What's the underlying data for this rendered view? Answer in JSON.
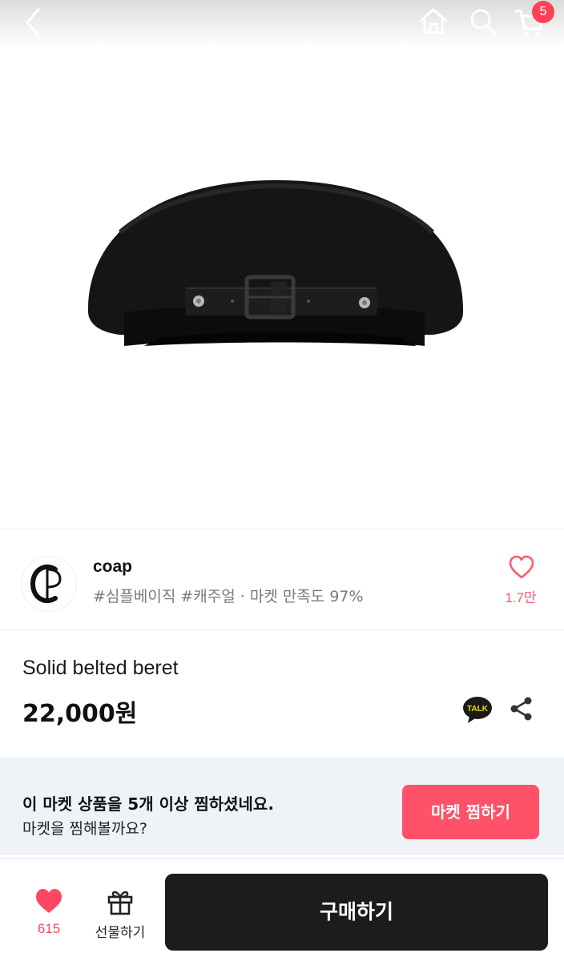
{
  "header": {
    "back_icon": "chevron-left-icon",
    "home_icon": "home-icon",
    "search_icon": "search-icon",
    "cart_icon": "cart-icon",
    "cart_badge": "5"
  },
  "product_image": {
    "subject": "black belted beret"
  },
  "shop": {
    "name": "coap",
    "meta": "#심플베이직 #캐주얼 · 마켓 만족도 97%",
    "favorite_icon": "heart-outline-icon",
    "favorite_count": "1.7만"
  },
  "product": {
    "title": "Solid belted beret",
    "price": "22,000원",
    "talk_icon": "kakao-talk-icon",
    "talk_label": "TALK",
    "share_icon": "share-icon"
  },
  "banner": {
    "title": "이 마켓 상품을 5개 이상 찜하셨네요.",
    "subtitle": "마켓을 찜해볼까요?",
    "button_label": "마켓 찜하기"
  },
  "bottom_bar": {
    "like_count": "615",
    "gift_label": "선물하기",
    "buy_label": "구매하기"
  },
  "colors": {
    "accent": "#ff5167",
    "badge": "#ff4057",
    "buy_button": "#1c1c1c",
    "banner_bg": "#eef3f8"
  }
}
